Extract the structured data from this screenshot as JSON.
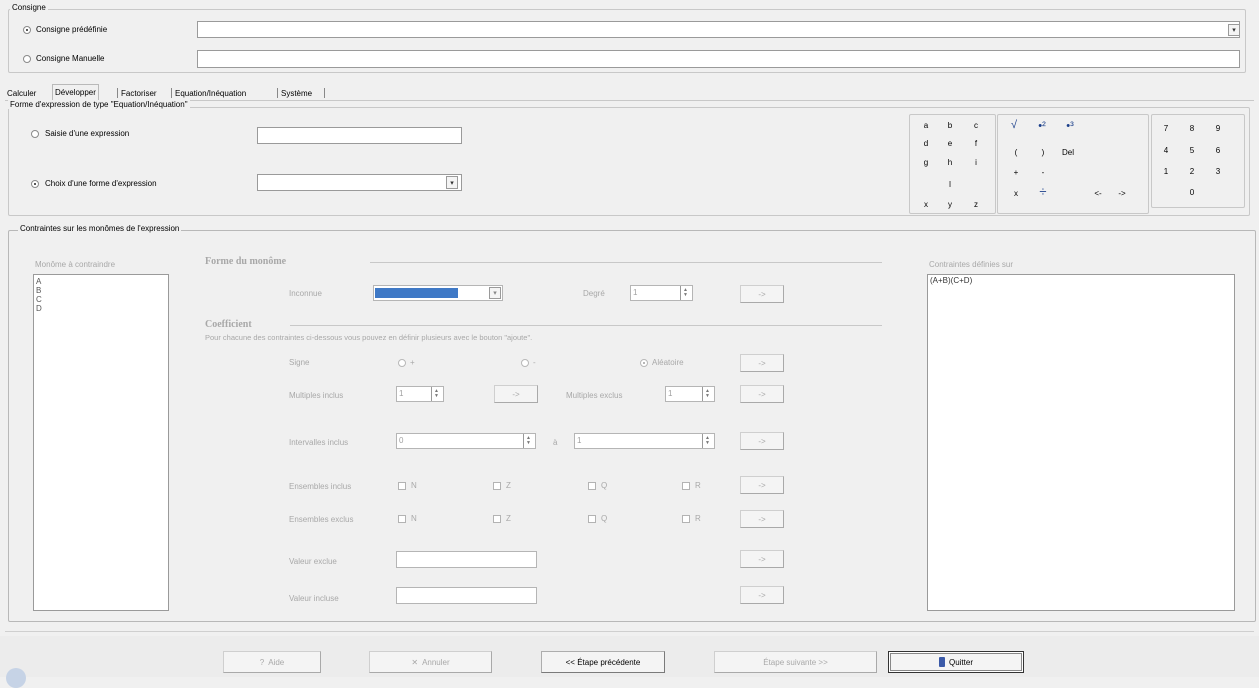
{
  "consigne": {
    "legend": "Consigne",
    "predef_label": "Consigne prédéfinie",
    "manual_label": "Consigne Manuelle",
    "predef_value": "",
    "manual_value": ""
  },
  "tabs": [
    "Calculer",
    "Développer",
    "Factoriser",
    "Equation/Inéquation",
    "Système"
  ],
  "forme": {
    "legend": "Forme d'expression de type \"Equation/Inéquation\"",
    "saisie_label": "Saisie d'une expression",
    "choix_label": "Choix d'une forme d'expression",
    "saisie_value": "",
    "choix_value": ""
  },
  "keypad": {
    "letters": [
      "a",
      "b",
      "c",
      "d",
      "e",
      "f",
      "g",
      "h",
      "i",
      "",
      "l",
      "",
      "x",
      "y",
      "z"
    ],
    "sym_row1": [
      "√",
      "•²",
      "•³"
    ],
    "sym_row2": [
      "(",
      ")",
      "Del"
    ],
    "sym_row3": [
      "+",
      "-"
    ],
    "sym_row4": [
      "x",
      "÷",
      "<-",
      "->"
    ],
    "digits": [
      "7",
      "8",
      "9",
      "4",
      "5",
      "6",
      "1",
      "2",
      "3",
      "",
      "0",
      ""
    ]
  },
  "contraintes": {
    "legend": "Contraintes sur les monômes de l'expression",
    "monomes_title": "Monôme à contraindre",
    "monomes": [
      "A",
      "B",
      "C",
      "D"
    ],
    "forme_title": "Forme du monôme",
    "inconnue_label": "Inconnue",
    "degre_label": "Degré",
    "degre_value": "1",
    "coef_title": "Coefficient",
    "coef_hint": "Pour chacune des contraintes ci-dessous vous pouvez en définir plusieurs avec le bouton \"ajoute\".",
    "signe_label": "Signe",
    "signe_plus": "+",
    "signe_minus": "-",
    "signe_aleatoire": "Aléatoire",
    "multiples_inclus_label": "Multiples inclus",
    "multiples_inclus_value": "1",
    "multiples_exclus_label": "Multiples exclus",
    "multiples_exclus_value": "1",
    "intervalles_label": "Intervalles inclus",
    "intervalle_from": "0",
    "intervalle_to": "1",
    "intervalle_sep": "à",
    "ensembles_inclus_label": "Ensembles inclus",
    "ensembles_exclus_label": "Ensembles exclus",
    "sets": [
      "N",
      "Z",
      "Q",
      "R"
    ],
    "valeur_exclue_label": "Valeur exclue",
    "valeur_incluse_label": "Valeur incluse",
    "arrow_btn": "->",
    "definies_title": "Contraintes définies sur",
    "definies_value": "(A+B)(C+D)"
  },
  "footer": {
    "aide": "Aide",
    "annuler": "Annuler",
    "precedente": "<< Étape précédente",
    "suivante": "Étape suivante >>",
    "quitter": "Quitter"
  }
}
